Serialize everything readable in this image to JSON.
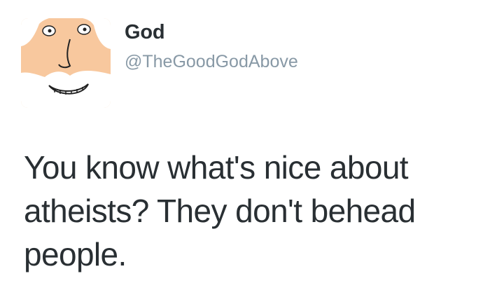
{
  "tweet": {
    "author": {
      "display_name": "God",
      "handle": "@TheGoodGodAbove",
      "avatar_icon": "god-cartoon-face-avatar"
    },
    "text": "You know what's nice about atheists? They don't behead people."
  },
  "colors": {
    "background": "#ffffff",
    "text": "#292f33",
    "handle": "#8899a6",
    "avatar_skin": "#f8c89e"
  }
}
